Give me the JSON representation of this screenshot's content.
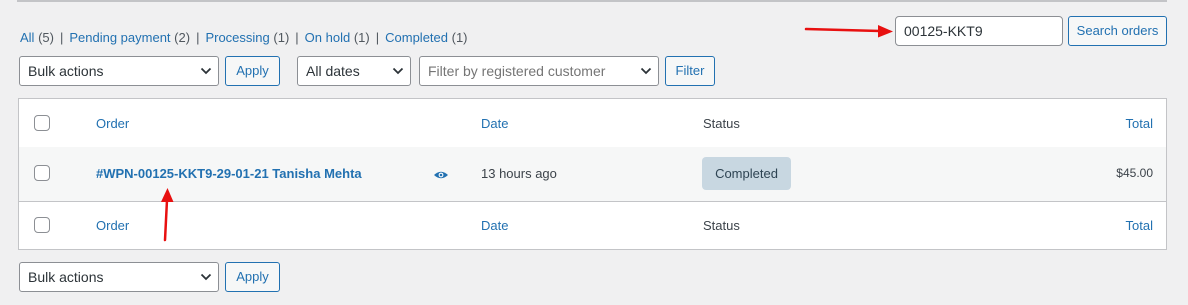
{
  "status_filters": [
    {
      "label": "All",
      "count": "(5)"
    },
    {
      "label": "Pending payment",
      "count": "(2)"
    },
    {
      "label": "Processing",
      "count": "(1)"
    },
    {
      "label": "On hold",
      "count": "(1)"
    },
    {
      "label": "Completed",
      "count": "(1)"
    }
  ],
  "search": {
    "value": "00125-KKT9",
    "button": "Search orders"
  },
  "toolbar_top": {
    "bulk_actions": "Bulk actions",
    "apply": "Apply",
    "dates": "All dates",
    "customer_placeholder": "Filter by registered customer",
    "filter": "Filter"
  },
  "table": {
    "columns": {
      "order": "Order",
      "date": "Date",
      "status": "Status",
      "total": "Total"
    },
    "rows": [
      {
        "order": "#WPN-00125-KKT9-29-01-21 Tanisha Mehta",
        "date": "13 hours ago",
        "status": "Completed",
        "total": "$45.00"
      }
    ]
  },
  "toolbar_bottom": {
    "bulk_actions": "Bulk actions",
    "apply": "Apply"
  },
  "colors": {
    "link": "#2271b1",
    "annotation_arrow": "#e81010",
    "status_completed_bg": "#c8d7e1"
  },
  "icons": {
    "preview": "eye-icon",
    "dropdown": "chevron-down-icon"
  }
}
